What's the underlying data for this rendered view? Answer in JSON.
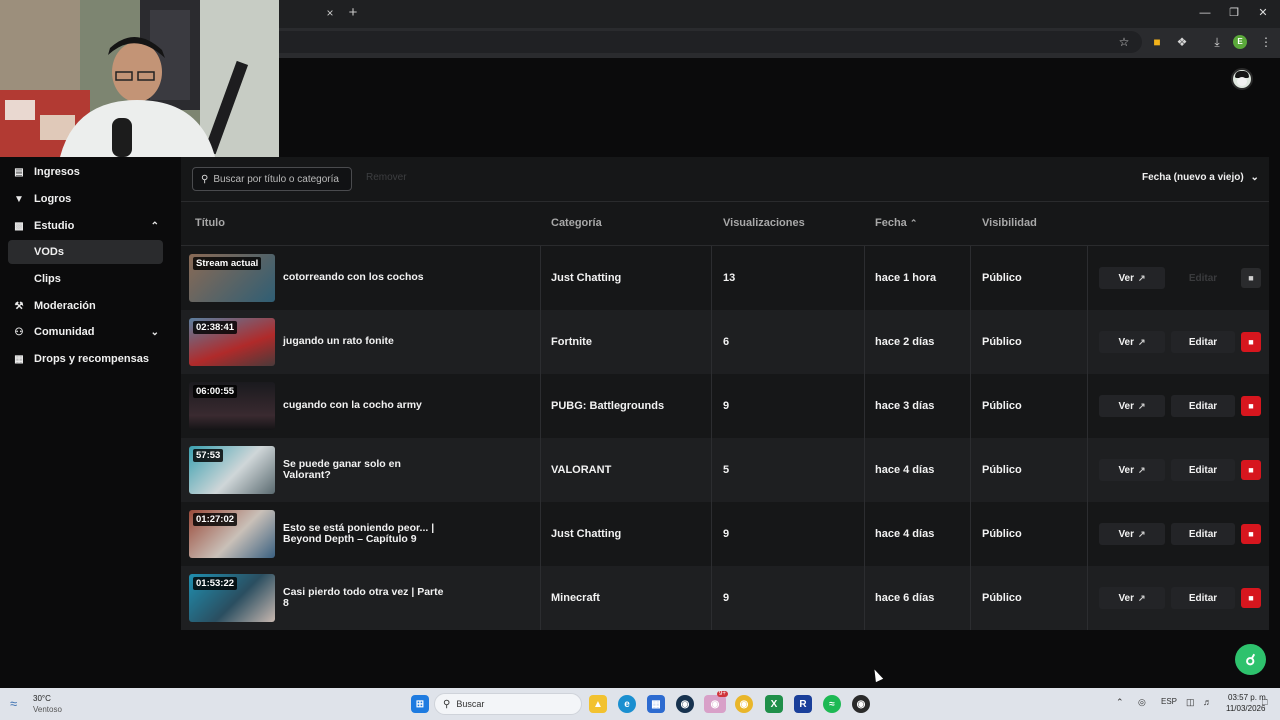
{
  "browser": {
    "tab_close_glyph": "×",
    "tab_new_glyph": "+",
    "profile_initial": "E"
  },
  "sidebar": {
    "items": [
      {
        "label": "Ingresos",
        "icon": "bar-chart-icon"
      },
      {
        "label": "Logros",
        "icon": "trophy-icon"
      },
      {
        "label": "Estudio",
        "icon": "studio-icon",
        "expanded": true
      },
      {
        "label": "VODs",
        "sub": true,
        "active": true
      },
      {
        "label": "Clips",
        "sub": true
      },
      {
        "label": "Moderación",
        "icon": "wrench-icon"
      },
      {
        "label": "Comunidad",
        "icon": "community-icon",
        "expanded": false
      },
      {
        "label": "Drops y recompensas",
        "icon": "drops-icon"
      }
    ]
  },
  "toolbar": {
    "search_placeholder": "Buscar por título o categoría",
    "remove_label": "Remover",
    "sort_label": "Fecha (nuevo a viejo)"
  },
  "table": {
    "headers": {
      "title": "Título",
      "category": "Categoría",
      "views": "Visualizaciones",
      "date": "Fecha",
      "visibility": "Visibilidad"
    },
    "view_label": "Ver",
    "edit_label": "Editar",
    "rows": [
      {
        "duration": "Stream actual",
        "title": "cotorreando con los cochos",
        "category": "Just Chatting",
        "views": "13",
        "date": "hace 1 hora",
        "visibility": "Público",
        "edit_disabled": true
      },
      {
        "duration": "02:38:41",
        "title": "jugando un rato fonite",
        "category": "Fortnite",
        "views": "6",
        "date": "hace 2 días",
        "visibility": "Público",
        "edit_disabled": false
      },
      {
        "duration": "06:00:55",
        "title": "cugando con la cocho army",
        "category": "PUBG: Battlegrounds",
        "views": "9",
        "date": "hace 3 días",
        "visibility": "Público",
        "edit_disabled": false
      },
      {
        "duration": "57:53",
        "title": "Se puede ganar solo en Valorant?",
        "category": "VALORANT",
        "views": "5",
        "date": "hace 4 días",
        "visibility": "Público",
        "edit_disabled": false
      },
      {
        "duration": "01:27:02",
        "title": "Esto se está poniendo peor... | Beyond Depth – Capítulo 9",
        "category": "Just Chatting",
        "views": "9",
        "date": "hace 4 días",
        "visibility": "Público",
        "edit_disabled": false
      },
      {
        "duration": "01:53:22",
        "title": "Casi pierdo todo otra vez | Parte 8",
        "category": "Minecraft",
        "views": "9",
        "date": "hace 6 días",
        "visibility": "Público",
        "edit_disabled": false
      }
    ]
  },
  "taskbar": {
    "weather_temp": "30°C",
    "weather_desc": "Ventoso",
    "search_label": "Buscar",
    "discord_badge": "9+",
    "language": "ESP",
    "time": "03:57 p. m.",
    "date": "11/03/2026"
  },
  "colors": {
    "accent_danger": "#d7161e",
    "help_green": "#2ec26d"
  }
}
